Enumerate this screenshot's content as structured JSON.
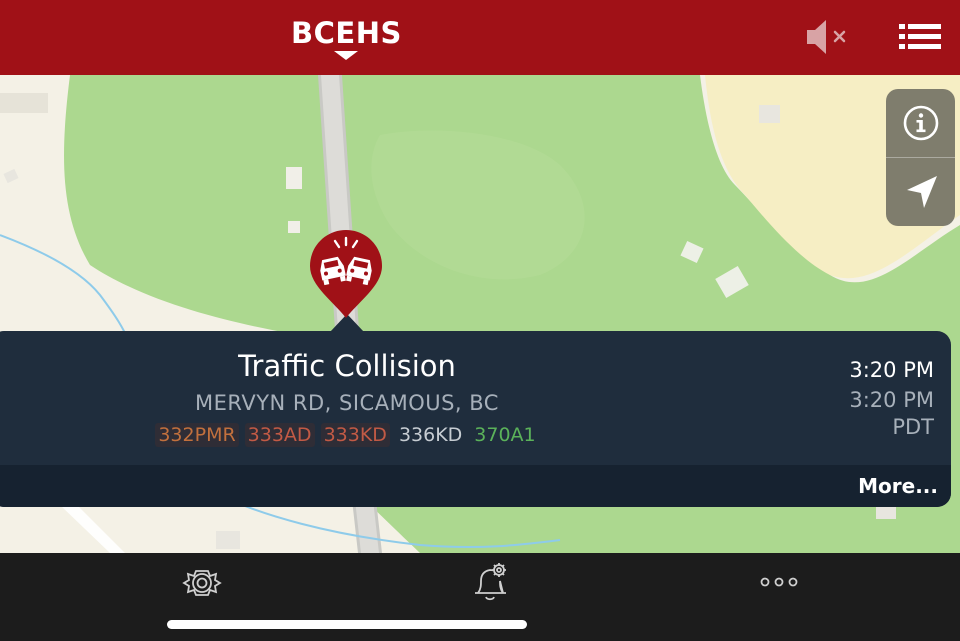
{
  "header": {
    "brand": "BCEHS",
    "mute_icon": "speaker-muted-icon",
    "menu_icon": "list-menu-icon",
    "background": "#a01117"
  },
  "map": {
    "controls": {
      "info_icon": "info-icon",
      "location_icon": "location-arrow-icon"
    },
    "pin_icon": "traffic-collision-icon",
    "pin_color": "#a01117"
  },
  "incident": {
    "title": "Traffic Collision",
    "address": "MERVYN RD, SICAMOUS, BC",
    "units": [
      {
        "label": "332PMR",
        "color": "#c2703d",
        "bg": "#2f2d36"
      },
      {
        "label": "333AD",
        "color": "#c25a45",
        "bg": "#2f2d36"
      },
      {
        "label": "333KD",
        "color": "#c25a45",
        "bg": "#2f2d36"
      },
      {
        "label": "336KD",
        "color": "#c6ccd2",
        "bg": "transparent"
      },
      {
        "label": "370A1",
        "color": "#5bb25a",
        "bg": "transparent"
      }
    ],
    "time": "3:20 PM",
    "time_secondary": "3:20 PM",
    "timezone": "PDT",
    "more_label": "More..."
  },
  "tabbar": {
    "items": [
      {
        "name": "incidents",
        "icon": "fire-rescue-emblem-icon"
      },
      {
        "name": "alerts",
        "icon": "bell-settings-icon"
      },
      {
        "name": "more",
        "icon": "ellipsis-icon"
      }
    ]
  }
}
